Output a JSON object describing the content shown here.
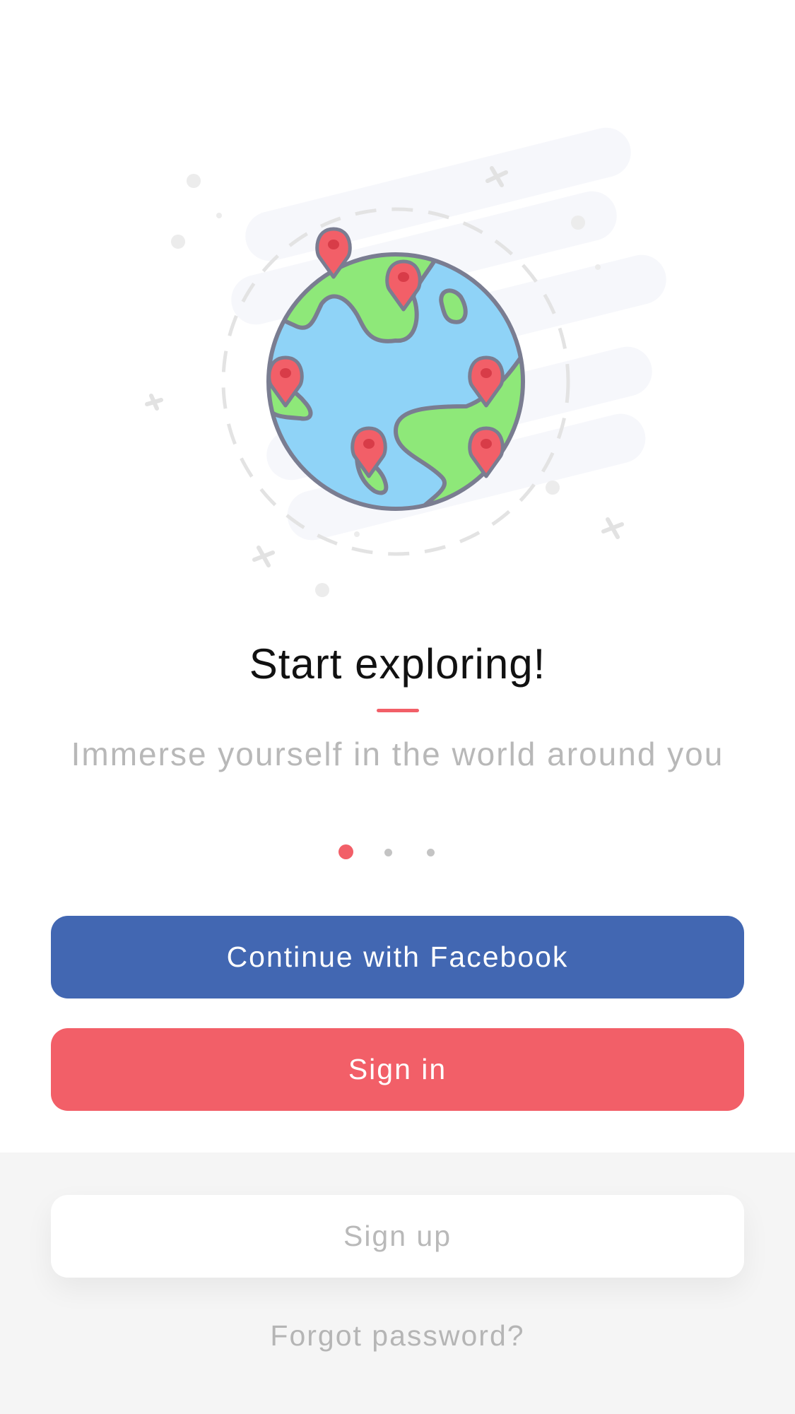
{
  "colors": {
    "accent": "#f25f68",
    "facebook": "#4267b2",
    "ocean": "#8fd3f7",
    "land": "#8ee879",
    "outline": "#7a7d91"
  },
  "hero": {
    "illustration": "globe-with-map-pins",
    "pin_count": 6
  },
  "onboarding": {
    "title": "Start exploring!",
    "subtitle": "Immerse yourself in the world around you",
    "page_indicator": {
      "current": 1,
      "total": 3
    }
  },
  "actions": {
    "facebook_label": "Continue with Facebook",
    "signin_label": "Sign in",
    "signup_label": "Sign up",
    "forgot_label": "Forgot password?"
  }
}
